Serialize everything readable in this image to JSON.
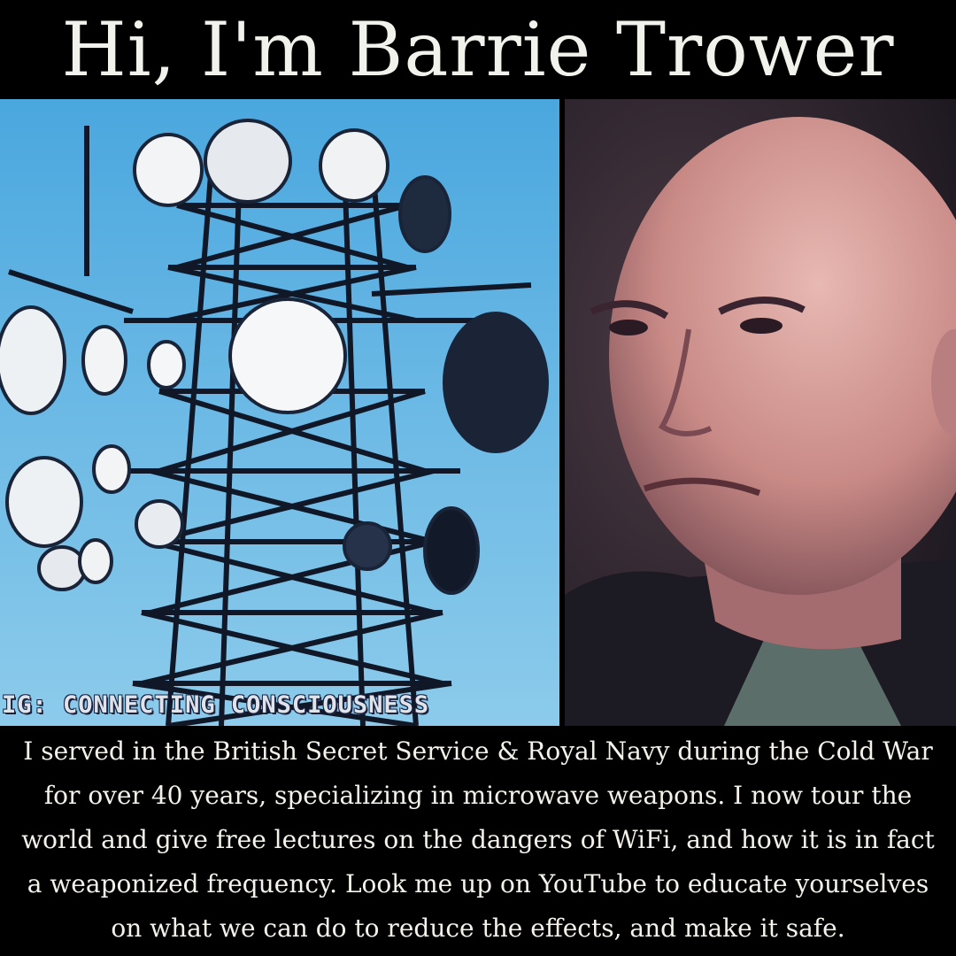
{
  "header": {
    "title": "Hi, I'm Barrie Trower"
  },
  "left_image": {
    "subject": "telecommunication-tower",
    "watermark": "IG: CONNECTING CONSCIOUSNESS"
  },
  "right_image": {
    "subject": "portrait-of-man"
  },
  "caption": {
    "lines": [
      "I served in the British Secret Service & Royal Navy during the Cold War",
      "for over 40 years, specializing in microwave weapons. I now tour the",
      "world and give free lectures on the dangers of WiFi, and how it is in fact",
      "a weaponized frequency. Look me up on YouTube to educate yourselves",
      "on what we can do to reduce the effects, and make it safe."
    ]
  },
  "colors": {
    "background": "#000000",
    "sky": "#5ab0e2",
    "text": "#f4f2ea"
  }
}
